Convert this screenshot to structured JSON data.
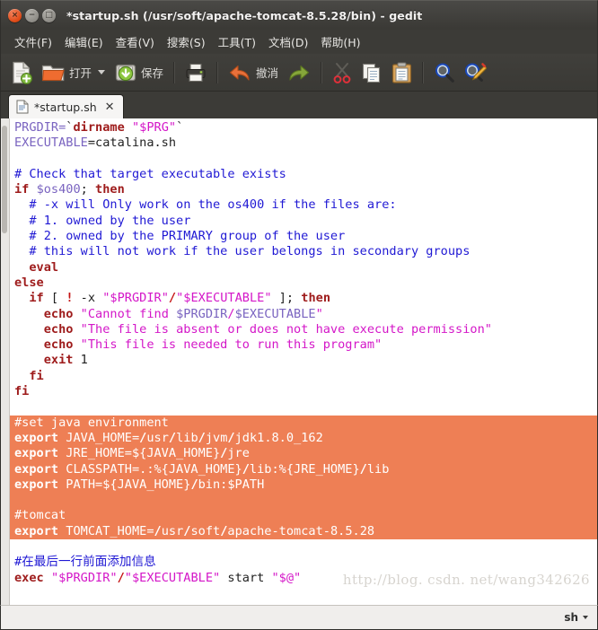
{
  "window": {
    "title": "*startup.sh (/usr/soft/apache-tomcat-8.5.28/bin) - gedit",
    "close_glyph": "×",
    "minimize_glyph": "−",
    "maximize_glyph": "□"
  },
  "menu": {
    "items": [
      {
        "label": "文件(F)"
      },
      {
        "label": "编辑(E)"
      },
      {
        "label": "查看(V)"
      },
      {
        "label": "搜索(S)"
      },
      {
        "label": "工具(T)"
      },
      {
        "label": "文档(D)"
      },
      {
        "label": "帮助(H)"
      }
    ]
  },
  "toolbar": {
    "new_label": "",
    "open_label": "打开",
    "save_label": "保存",
    "print_label": "",
    "undo_label": "撤消",
    "redo_label": "",
    "cut_label": "",
    "copy_label": "",
    "paste_label": "",
    "find_label": "",
    "replace_label": ""
  },
  "tab": {
    "label": "*startup.sh",
    "close_glyph": "✕"
  },
  "editor": {
    "watermark": "http://blog. csdn. net/wang342626",
    "lines": [
      {
        "selected": false,
        "tokens": [
          {
            "t": "var",
            "s": "PRGDIR="
          },
          {
            "t": "plain",
            "s": "`"
          },
          {
            "t": "kw",
            "s": "dirname"
          },
          {
            "t": "plain",
            "s": " "
          },
          {
            "t": "str",
            "s": "\"$PRG\""
          },
          {
            "t": "plain",
            "s": "`"
          }
        ]
      },
      {
        "selected": false,
        "tokens": [
          {
            "t": "var",
            "s": "EXECUTABLE"
          },
          {
            "t": "plain",
            "s": "=catalina.sh"
          }
        ]
      },
      {
        "selected": false,
        "tokens": []
      },
      {
        "selected": false,
        "tokens": [
          {
            "t": "cmt",
            "s": "# Check that target executable exists"
          }
        ]
      },
      {
        "selected": false,
        "tokens": [
          {
            "t": "kw",
            "s": "if"
          },
          {
            "t": "plain",
            "s": " "
          },
          {
            "t": "var",
            "s": "$os400"
          },
          {
            "t": "plain",
            "s": "; "
          },
          {
            "t": "kw",
            "s": "then"
          }
        ]
      },
      {
        "selected": false,
        "tokens": [
          {
            "t": "cmt",
            "s": "  # -x will Only work on the os400 if the files are:"
          }
        ]
      },
      {
        "selected": false,
        "tokens": [
          {
            "t": "cmt",
            "s": "  # 1. owned by the user"
          }
        ]
      },
      {
        "selected": false,
        "tokens": [
          {
            "t": "cmt",
            "s": "  # 2. owned by the PRIMARY group of the user"
          }
        ]
      },
      {
        "selected": false,
        "tokens": [
          {
            "t": "cmt",
            "s": "  # this will not work if the user belongs in secondary groups"
          }
        ]
      },
      {
        "selected": false,
        "tokens": [
          {
            "t": "kw",
            "s": "  eval"
          }
        ]
      },
      {
        "selected": false,
        "tokens": [
          {
            "t": "kw",
            "s": "else"
          }
        ]
      },
      {
        "selected": false,
        "tokens": [
          {
            "t": "kw",
            "s": "  if"
          },
          {
            "t": "plain",
            "s": " [ "
          },
          {
            "t": "op",
            "s": "!"
          },
          {
            "t": "plain",
            "s": " -x "
          },
          {
            "t": "str",
            "s": "\"$PRGDIR\""
          },
          {
            "t": "op",
            "s": "/"
          },
          {
            "t": "str",
            "s": "\"$EXECUTABLE\""
          },
          {
            "t": "plain",
            "s": " ]; "
          },
          {
            "t": "kw",
            "s": "then"
          }
        ]
      },
      {
        "selected": false,
        "tokens": [
          {
            "t": "kw",
            "s": "    echo"
          },
          {
            "t": "plain",
            "s": " "
          },
          {
            "t": "str",
            "s": "\"Cannot find "
          },
          {
            "t": "var",
            "s": "$PRGDIR"
          },
          {
            "t": "str",
            "s": "/"
          },
          {
            "t": "var",
            "s": "$EXECUTABLE"
          },
          {
            "t": "str",
            "s": "\""
          }
        ]
      },
      {
        "selected": false,
        "tokens": [
          {
            "t": "kw",
            "s": "    echo"
          },
          {
            "t": "plain",
            "s": " "
          },
          {
            "t": "str",
            "s": "\"The file is absent or does not have execute permission\""
          }
        ]
      },
      {
        "selected": false,
        "tokens": [
          {
            "t": "kw",
            "s": "    echo"
          },
          {
            "t": "plain",
            "s": " "
          },
          {
            "t": "str",
            "s": "\"This file is needed to run this program\""
          }
        ]
      },
      {
        "selected": false,
        "tokens": [
          {
            "t": "kw",
            "s": "    exit"
          },
          {
            "t": "plain",
            "s": " "
          },
          {
            "t": "num",
            "s": "1"
          }
        ]
      },
      {
        "selected": false,
        "tokens": [
          {
            "t": "kw",
            "s": "  fi"
          }
        ]
      },
      {
        "selected": false,
        "tokens": [
          {
            "t": "kw",
            "s": "fi"
          }
        ]
      },
      {
        "selected": false,
        "tokens": []
      },
      {
        "selected": true,
        "tokens": [
          {
            "t": "cmt",
            "s": "#set java environment"
          }
        ]
      },
      {
        "selected": true,
        "tokens": [
          {
            "t": "kw",
            "s": "export"
          },
          {
            "t": "plain",
            "s": " JAVA_HOME="
          },
          {
            "t": "op",
            "s": "/"
          },
          {
            "t": "plain",
            "s": "usr"
          },
          {
            "t": "op",
            "s": "/"
          },
          {
            "t": "plain",
            "s": "lib"
          },
          {
            "t": "op",
            "s": "/"
          },
          {
            "t": "plain",
            "s": "jvm"
          },
          {
            "t": "op",
            "s": "/"
          },
          {
            "t": "plain",
            "s": "jdk1.8.0_162"
          }
        ]
      },
      {
        "selected": true,
        "tokens": [
          {
            "t": "kw",
            "s": "export"
          },
          {
            "t": "plain",
            "s": " JRE_HOME=${JAVA_HOME}"
          },
          {
            "t": "op",
            "s": "/"
          },
          {
            "t": "plain",
            "s": "jre"
          }
        ]
      },
      {
        "selected": true,
        "tokens": [
          {
            "t": "kw",
            "s": "export"
          },
          {
            "t": "plain",
            "s": " CLASSPATH=.:%{JAVA_HOME}"
          },
          {
            "t": "op",
            "s": "/"
          },
          {
            "t": "plain",
            "s": "lib:%{JRE_HOME}"
          },
          {
            "t": "op",
            "s": "/"
          },
          {
            "t": "plain",
            "s": "lib"
          }
        ]
      },
      {
        "selected": true,
        "tokens": [
          {
            "t": "kw",
            "s": "export"
          },
          {
            "t": "plain",
            "s": " PATH=${JAVA_HOME}"
          },
          {
            "t": "op",
            "s": "/"
          },
          {
            "t": "plain",
            "s": "bin:$PATH"
          }
        ]
      },
      {
        "selected": true,
        "tokens": []
      },
      {
        "selected": true,
        "tokens": [
          {
            "t": "cmt",
            "s": "#tomcat"
          }
        ]
      },
      {
        "selected": true,
        "tokens": [
          {
            "t": "kw",
            "s": "export"
          },
          {
            "t": "plain",
            "s": " TOMCAT_HOME="
          },
          {
            "t": "op",
            "s": "/"
          },
          {
            "t": "plain",
            "s": "usr"
          },
          {
            "t": "op",
            "s": "/"
          },
          {
            "t": "plain",
            "s": "soft"
          },
          {
            "t": "op",
            "s": "/"
          },
          {
            "t": "plain",
            "s": "apache-tomcat-8.5.28"
          }
        ]
      },
      {
        "selected": false,
        "tokens": []
      },
      {
        "selected": false,
        "tokens": [
          {
            "t": "cmt",
            "s": "#在最后一行前面添加信息"
          }
        ]
      },
      {
        "selected": false,
        "tokens": [
          {
            "t": "kw",
            "s": "exec"
          },
          {
            "t": "plain",
            "s": " "
          },
          {
            "t": "str",
            "s": "\"$PRGDIR\""
          },
          {
            "t": "op",
            "s": "/"
          },
          {
            "t": "str",
            "s": "\"$EXECUTABLE\""
          },
          {
            "t": "plain",
            "s": " start "
          },
          {
            "t": "str",
            "s": "\"$@\""
          }
        ]
      }
    ]
  },
  "statusbar": {
    "language": "sh"
  },
  "colors": {
    "selection_bg": "#ee7f55",
    "comment": "#2019d4",
    "keyword": "#9e1b1b",
    "string": "#d417c8",
    "variable": "#7a64c0",
    "chrome": "#3c3b37",
    "accent": "#dd4814"
  }
}
